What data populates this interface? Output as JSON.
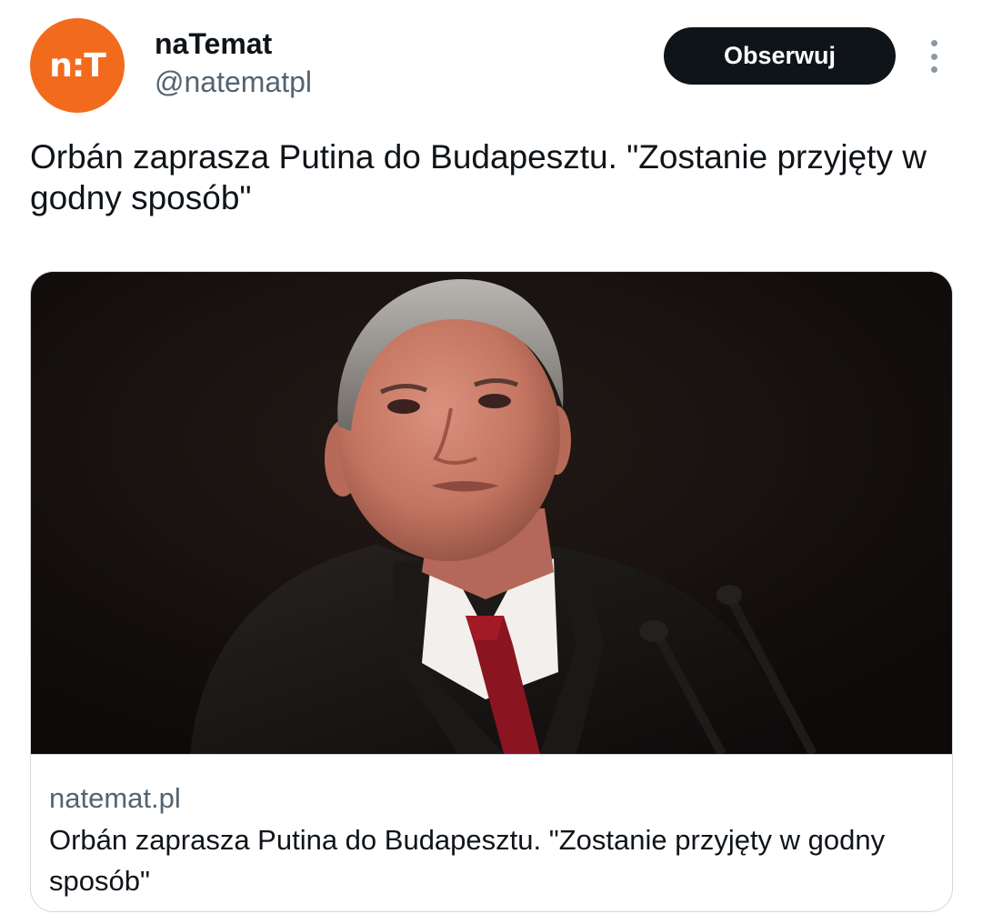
{
  "author": {
    "avatar_text": "n:T",
    "display_name": "naTemat",
    "handle": "@natematpl"
  },
  "actions": {
    "follow_label": "Obserwuj",
    "more_icon": "more-vertical-icon"
  },
  "tweet": {
    "text": "Orbán zaprasza Putina do Budapesztu. \"Zostanie przyjęty w godny sposób\""
  },
  "link_card": {
    "domain": "natemat.pl",
    "title": "Orbán zaprasza Putina do Budapesztu. \"Zostanie przyjęty w godny sposób\""
  },
  "colors": {
    "avatar_bg": "#f26b1d",
    "button_bg": "#0f1419",
    "secondary_text": "#536471"
  }
}
